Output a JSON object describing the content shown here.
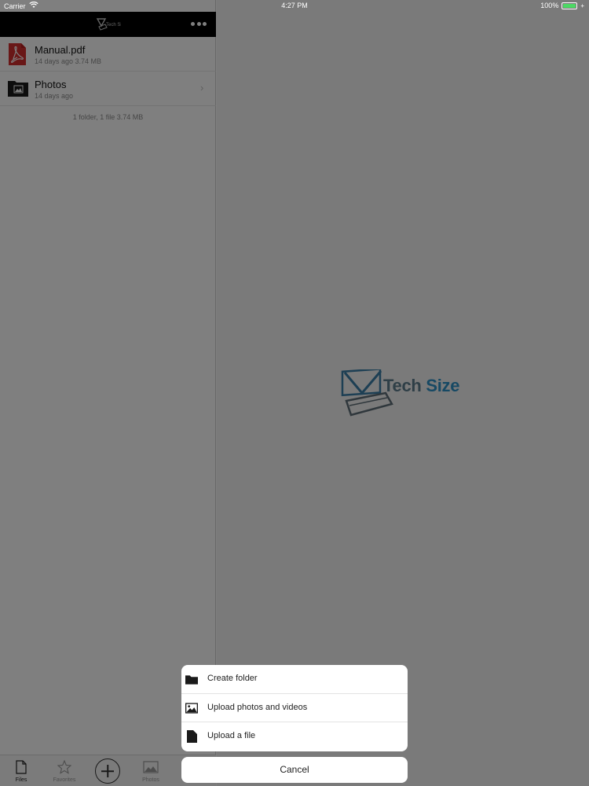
{
  "status_bar": {
    "carrier": "Carrier",
    "time": "4:27 PM",
    "battery": "100%",
    "battery_color": "#4cd964"
  },
  "header": {
    "logo_icon": "tech-size-logo-icon",
    "more_icon": "more-dots-icon"
  },
  "files": [
    {
      "name": "Manual.pdf",
      "meta": "14 days ago 3.74 MB",
      "icon": "pdf-file-icon"
    },
    {
      "name": "Photos",
      "meta": "14 days ago",
      "icon": "photo-folder-icon"
    }
  ],
  "summary": "1 folder, 1 file 3.74 MB",
  "tabbar": {
    "files": "Files",
    "favorites": "Favorites",
    "photos": "Photos"
  },
  "watermark": {
    "word1": "Tech",
    "word2": "Size"
  },
  "action_sheet": {
    "items": [
      {
        "label": "Create folder",
        "icon": "folder-icon"
      },
      {
        "label": "Upload photos and videos",
        "icon": "image-icon"
      },
      {
        "label": "Upload a file",
        "icon": "file-icon"
      }
    ],
    "cancel": "Cancel"
  },
  "colors": {
    "header_bg": "#000000",
    "pdf_red": "#d32f2f",
    "brand_blue": "#2f93c8"
  }
}
